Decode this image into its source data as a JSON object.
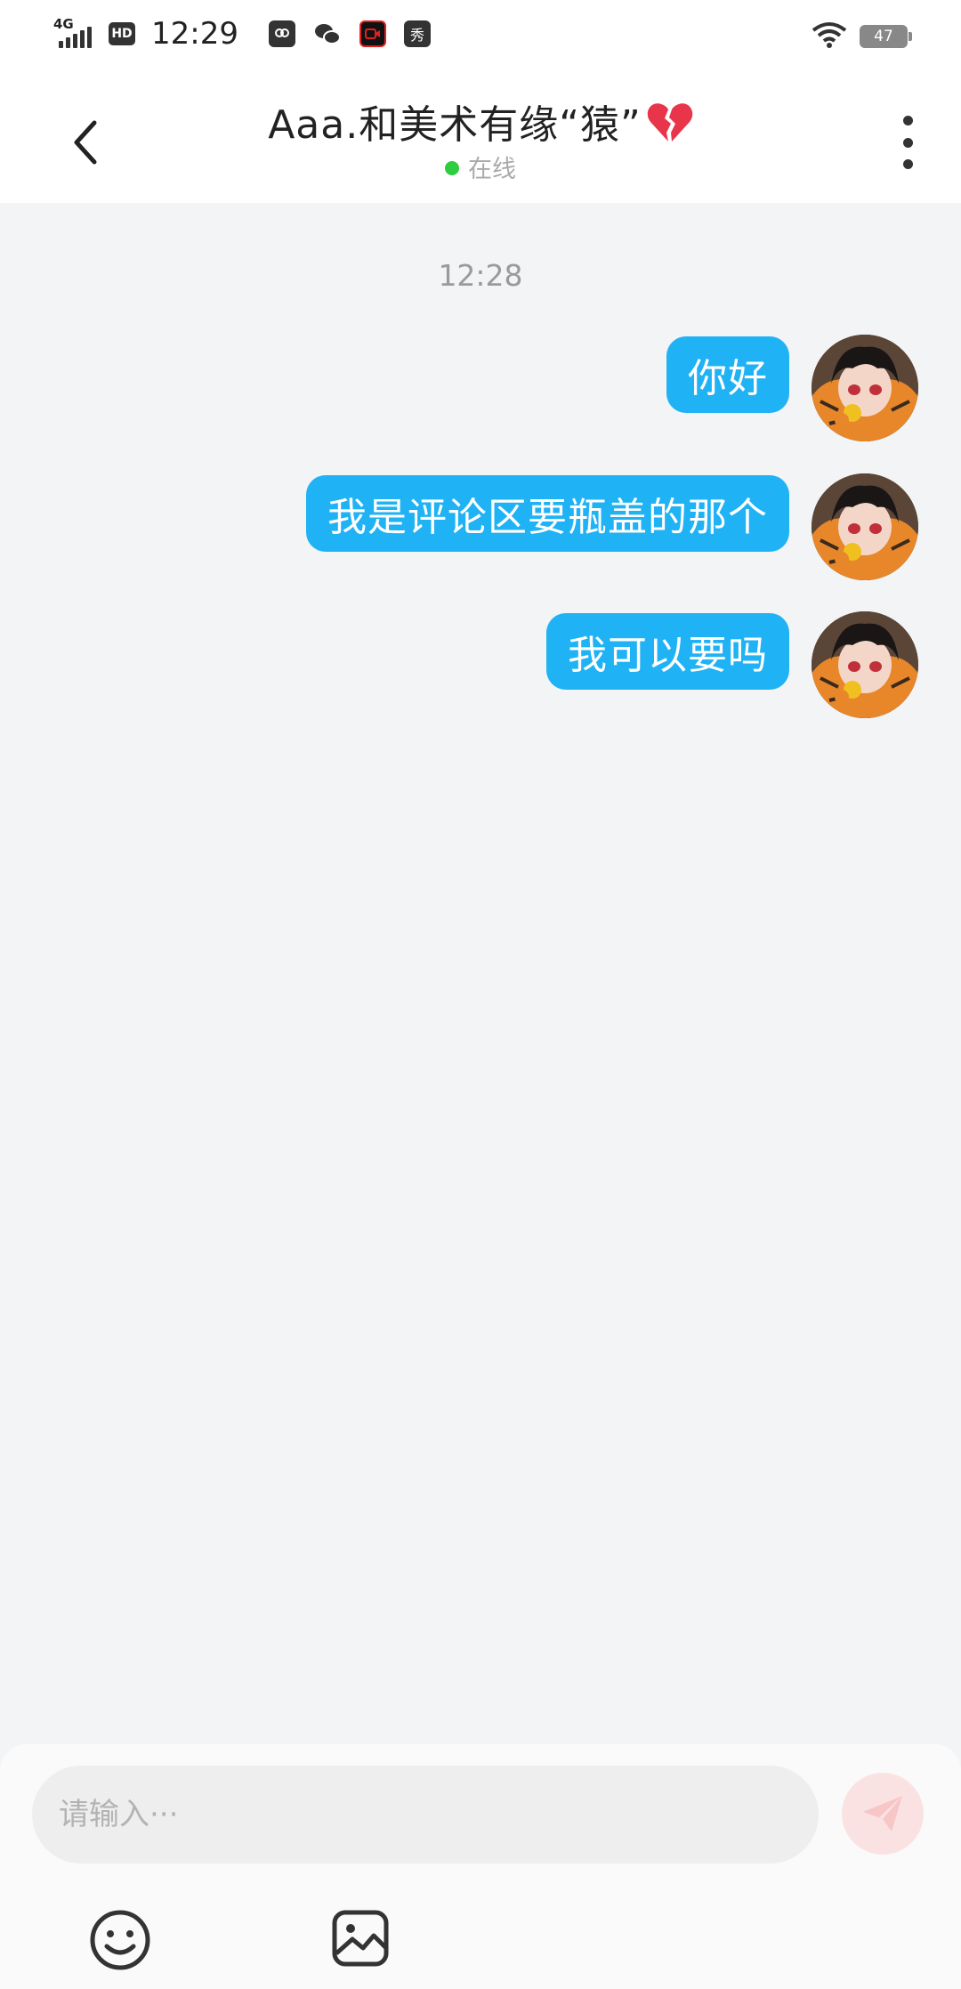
{
  "status_bar": {
    "network": "4G",
    "hd": "HD",
    "time": "12:29",
    "notif_badge": "秀",
    "battery": "47"
  },
  "header": {
    "title": "Aaa.和美术有缘“猿”",
    "status": "在线"
  },
  "chat": {
    "timestamp": "12:28",
    "messages": [
      {
        "text": "你好",
        "sender": "self"
      },
      {
        "text": "我是评论区要瓶盖的那个",
        "sender": "self"
      },
      {
        "text": "我可以要吗",
        "sender": "self"
      }
    ]
  },
  "composer": {
    "placeholder": "请输入···"
  },
  "colors": {
    "bubble": "#1fb2f5",
    "online_dot": "#2ecc40",
    "send_button": "#fbe2e2"
  }
}
